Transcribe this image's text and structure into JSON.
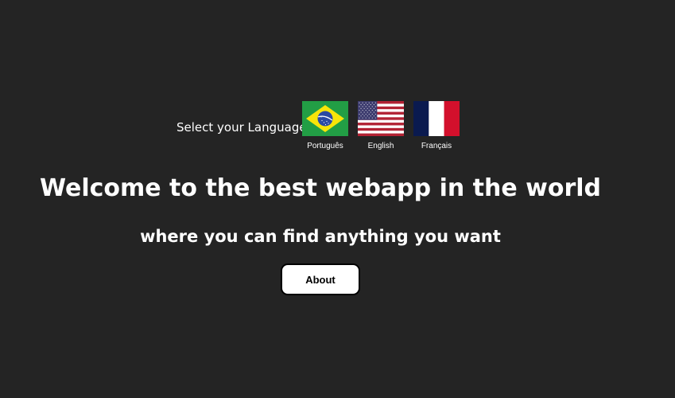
{
  "language_selector": {
    "label": "Select your Language",
    "options": [
      {
        "name": "Português",
        "flag": "brazil-flag"
      },
      {
        "name": "English",
        "flag": "usa-flag"
      },
      {
        "name": "Français",
        "flag": "france-flag"
      }
    ]
  },
  "hero": {
    "title": "Welcome to the best webapp in the world",
    "subtitle": "where you can find anything you want",
    "about_button": "About"
  },
  "colors": {
    "background": "#242424",
    "text": "#ffffff",
    "button_bg": "#ffffff",
    "button_text": "#000000"
  }
}
